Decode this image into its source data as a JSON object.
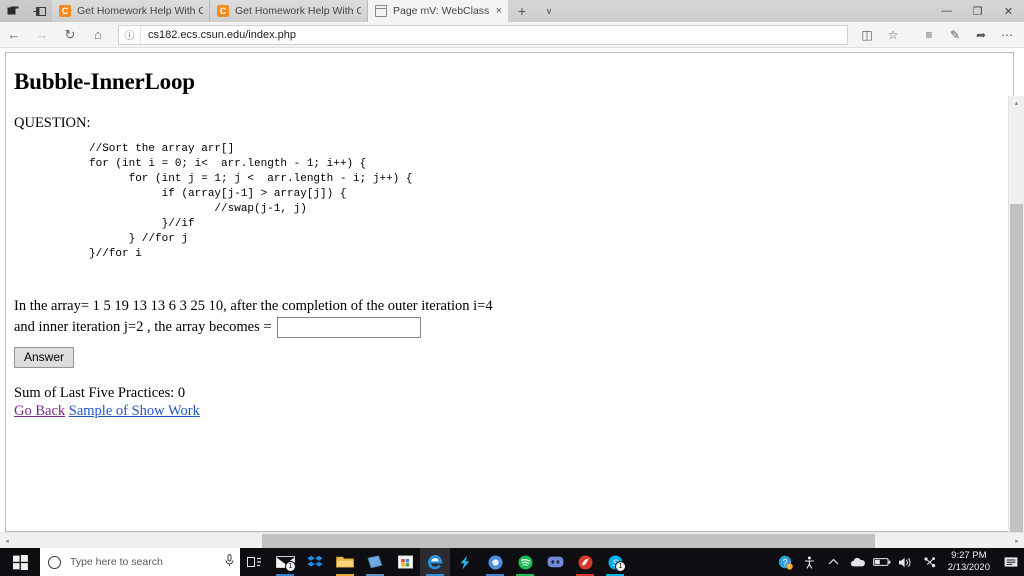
{
  "browser": {
    "tabs": [
      {
        "title": "Get Homework Help With C",
        "favicon": "chegg-c-icon",
        "active": false
      },
      {
        "title": "Get Homework Help With C",
        "favicon": "chegg-c-icon",
        "active": false
      },
      {
        "title": "Page mV: WebClass",
        "favicon": "page-icon",
        "active": true
      }
    ],
    "tab_close_glyph": "×",
    "new_tab_glyph": "+",
    "tab_list_glyph": "∨",
    "window_controls": {
      "minimize": "—",
      "restore": "❐",
      "close": "✕"
    },
    "nav": {
      "back": "←",
      "forward": "→",
      "refresh": "↻",
      "home": "⌂",
      "site_info": "ⓘ",
      "url": "cs182.ecs.csun.edu/index.php"
    },
    "toolbar_icons": [
      {
        "name": "reading-list-icon",
        "glyph": "◫"
      },
      {
        "name": "favorites-star-icon",
        "glyph": "☆"
      },
      {
        "name": "reading-view-icon",
        "glyph": "≡"
      },
      {
        "name": "ink-notes-icon",
        "glyph": "✎"
      },
      {
        "name": "share-icon",
        "glyph": "➦"
      },
      {
        "name": "settings-more-icon",
        "glyph": "⋯"
      }
    ]
  },
  "page": {
    "title": "Bubble-InnerLoop",
    "question_label": "QUESTION:",
    "code": "//Sort the array arr[]\nfor (int i = 0; i<  arr.length - 1; i++) {\n      for (int j = 1; j <  arr.length - i; j++) {\n           if (array[j-1] > array[j]) {\n                   //swap(j-1, j)\n           }//if\n      } //for j\n}//for i",
    "question_line1": "In the array= 1 5 19 13 13 6 3 25 10, after the completion of the outer iteration i=4",
    "question_line2_pre": "and inner iteration j=2 , the array becomes =",
    "answer_input_value": "",
    "answer_input_placeholder": "",
    "answer_button": "Answer",
    "score_line": "Sum of Last Five Practices: 0",
    "link_go_back": "Go Back",
    "link_sample": "Sample of Show Work",
    "scroll": {
      "up_arrow": "▴",
      "down_arrow": "▾",
      "left_arrow": "◂",
      "right_arrow": "▸"
    }
  },
  "question_content": {
    "array": [
      1,
      5,
      19,
      13,
      13,
      6,
      3,
      25,
      10
    ],
    "outer_iteration_i": 4,
    "inner_iteration_j": 2,
    "sum_of_last_five_practices": 0
  },
  "taskbar": {
    "start_glyph": "⊞",
    "search_placeholder": "Type here to search",
    "search_circle": "cortana-circle-icon",
    "mic_glyph": "ƨ",
    "pinned": [
      {
        "name": "task-view-icon",
        "glyph": "⧉",
        "color": "#e8e8e8",
        "underline": "",
        "badge": ""
      },
      {
        "name": "mail-icon",
        "glyph": "✉",
        "color": "#f2f2f2",
        "underline": "#2f7fd1",
        "badge": "1"
      },
      {
        "name": "dropbox-icon",
        "glyph": "❖",
        "color": "#1e8be6",
        "underline": "",
        "badge": ""
      },
      {
        "name": "file-explorer-icon",
        "glyph": "Ὄ1",
        "color": "#f0bb4e",
        "underline": "#e5a93a",
        "badge": ""
      },
      {
        "name": "sticky-notes-icon",
        "glyph": "◰",
        "color": "#6fa8dc",
        "underline": "#5b8fc0",
        "badge": ""
      },
      {
        "name": "microsoft-store-icon",
        "glyph": "▣",
        "color": "#f4f4f4",
        "underline": "",
        "badge": ""
      },
      {
        "name": "edge-browser-icon",
        "glyph": "e",
        "color": "#2b90d9",
        "underline": "#2b90d9",
        "badge": "",
        "active": true
      },
      {
        "name": "lightning-app-icon",
        "glyph": "⚡",
        "color": "#28b5e8",
        "underline": "",
        "badge": ""
      },
      {
        "name": "chrome-browser-icon",
        "glyph": "◉",
        "color": "#5a9bea",
        "underline": "#3f7fd0",
        "badge": ""
      },
      {
        "name": "spotify-icon",
        "glyph": "♫",
        "color": "#1db954",
        "underline": "#1db954",
        "badge": ""
      },
      {
        "name": "discord-icon",
        "glyph": "◑",
        "color": "#7289da",
        "underline": "",
        "badge": ""
      },
      {
        "name": "red-app-icon",
        "glyph": "●",
        "color": "#d8392c",
        "underline": "#d8392c",
        "badge": ""
      },
      {
        "name": "skype-icon",
        "glyph": "S",
        "color": "#00aff0",
        "underline": "#00aff0",
        "badge": "1"
      }
    ],
    "tray": [
      {
        "name": "help-support-icon",
        "glyph": "❓",
        "color": "#2f9fe0"
      },
      {
        "name": "accessibility-icon",
        "glyph": "आ",
        "color": "#e8e8e8"
      },
      {
        "name": "show-hidden-icons-chevron",
        "glyph": "⌃",
        "color": "#e8e8e8"
      },
      {
        "name": "onedrive-cloud-icon",
        "glyph": "☁",
        "color": "#e8e8e8"
      },
      {
        "name": "battery-icon",
        "glyph": "▭",
        "color": "#e8e8e8"
      },
      {
        "name": "volume-icon",
        "glyph": "ὐa",
        "color": "#e8e8e8"
      },
      {
        "name": "network-bluetooth-icon",
        "glyph": "☍",
        "color": "#e8e8e8"
      }
    ],
    "clock_time": "9:27 PM",
    "clock_date": "2/13/2020",
    "action_center_glyph": "▤"
  }
}
